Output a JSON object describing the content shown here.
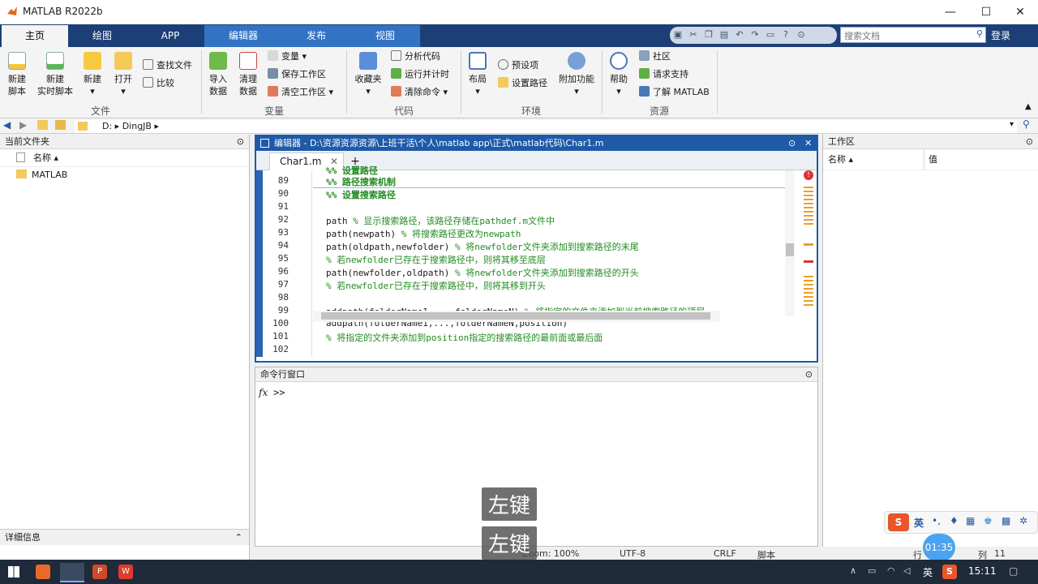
{
  "window": {
    "title": "MATLAB R2022b"
  },
  "tabs": [
    "主页",
    "绘图",
    "APP",
    "编辑器",
    "发布",
    "视图"
  ],
  "search": {
    "placeholder": "搜索文档"
  },
  "login": "登录",
  "ribbon": {
    "new_script": "新建\n脚本",
    "new_live_script": "新建\n实时脚本",
    "new": "新建",
    "open": "打开",
    "find_files": "查找文件",
    "compare": "比较",
    "group_file": "文件",
    "import": "导入\n数据",
    "clean": "清理\n数据",
    "variable": "变量",
    "save_ws": "保存工作区",
    "clear_ws": "清空工作区",
    "group_variable": "变量",
    "favorites": "收藏夹",
    "analyze": "分析代码",
    "run_time": "运行并计时",
    "clear_cmd": "清除命令",
    "group_code": "代码",
    "layout": "布局",
    "prefs": "预设项",
    "set_path": "设置路径",
    "addons": "附加功能",
    "group_env": "环境",
    "help": "帮助",
    "community": "社区",
    "support": "请求支持",
    "learn": "了解 MATLAB",
    "group_resources": "资源"
  },
  "address": {
    "drive": "D:",
    "folder": "DingJB"
  },
  "left_panel": {
    "title": "当前文件夹",
    "col_name": "名称",
    "item": "MATLAB",
    "details": "详细信息"
  },
  "editor": {
    "title": "编辑器 - D:\\资源资源资源\\上班干活\\个人\\matlab app\\正式\\matlab代码\\Char1.m",
    "tab": "Char1.m",
    "lines": [
      {
        "n": "89",
        "t": "%% 路径搜索机制"
      },
      {
        "n": "90",
        "t": "%% 设置搜索路径"
      },
      {
        "n": "91",
        "t": ""
      },
      {
        "n": "92",
        "t": "path % 显示搜索路径，该路径存储在pathdef.m文件中"
      },
      {
        "n": "93",
        "t": "path(newpath) % 将搜索路径更改为newpath"
      },
      {
        "n": "94",
        "t": "path(oldpath,newfolder) % 将newfolder文件夹添加到搜索路径的末尾"
      },
      {
        "n": "95",
        "t": "% 若newfolder已存在于搜索路径中，则将其移至底层"
      },
      {
        "n": "96",
        "t": "path(newfolder,oldpath) % 将newfolder文件夹添加到搜索路径的开头"
      },
      {
        "n": "97",
        "t": "% 若newfolder已存在于搜索路径中，则将其移到开头"
      },
      {
        "n": "98",
        "t": ""
      },
      {
        "n": "99",
        "t": "addpath(folderName1,...,folderNameN) % 将指定的文件夹添加到当前搜索路径的顶层"
      },
      {
        "n": "100",
        "t": "addpath(folderName1,...,folderNameN,position)"
      },
      {
        "n": "101",
        "t": "% 将指定的文件夹添加到position指定的搜索路径的最前面或最后面"
      },
      {
        "n": "102",
        "t": ""
      }
    ]
  },
  "cmd": {
    "title": "命令行窗口",
    "fx": "fx",
    "prompt": ">>"
  },
  "workspace": {
    "title": "工作区",
    "col_name": "名称",
    "col_value": "值"
  },
  "status": {
    "zoom": "Zoom: 100%",
    "encoding": "UTF-8",
    "eol": "CRLF",
    "type": "脚本",
    "row": "行",
    "col": "列",
    "col_val": "11"
  },
  "overlays": [
    "左键",
    "左键"
  ],
  "taskbar": {
    "ime": "英",
    "time": "15:11",
    "timer": "01:35",
    "ime_bar": "英"
  }
}
